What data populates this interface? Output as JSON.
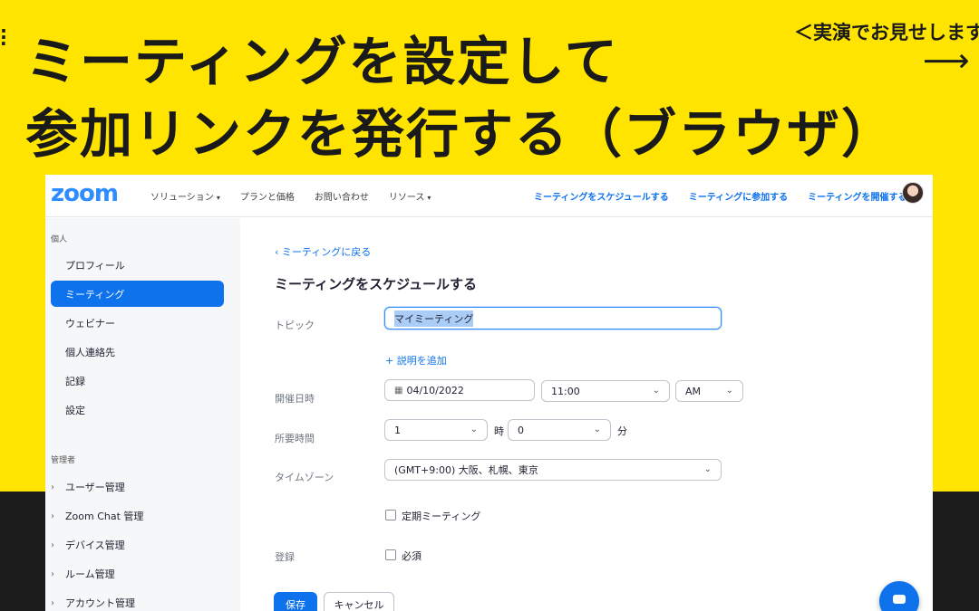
{
  "slide": {
    "title_line1": "ミーティングを設定して",
    "title_line2": "参加リンクを発行する（ブラウザ）",
    "demo_note": "＜実演でお見せします",
    "arrow": "⟶"
  },
  "colors": {
    "background": "#FFE400",
    "accent": "#0e72ed",
    "brand": "#2D8CFF"
  },
  "topnav": {
    "logo": "zoom",
    "left_items": [
      "ソリューション",
      "プランと価格",
      "お問い合わせ",
      "リソース"
    ],
    "right_items": [
      "ミーティングをスケジュールする",
      "ミーティングに参加する",
      "ミーティングを開催する"
    ]
  },
  "sidebar": {
    "personal_header": "個人",
    "items": [
      "プロフィール",
      "ミーティング",
      "ウェビナー",
      "個人連絡先",
      "記録",
      "設定"
    ],
    "active_index": 1,
    "admin_header": "管理者",
    "admin_items": [
      "ユーザー管理",
      "Zoom Chat 管理",
      "デバイス管理",
      "ルーム管理",
      "アカウント管理"
    ]
  },
  "form": {
    "back_link": "ミーティングに戻る",
    "heading": "ミーティングをスケジュールする",
    "topic_label": "トピック",
    "topic_value": "マイミーティング",
    "add_description": "説明を追加",
    "date_label": "開催日時",
    "date_value": "04/10/2022",
    "time_value": "11:00",
    "ampm_value": "AM",
    "duration_label": "所要時間",
    "hours_value": "1",
    "hours_unit": "時",
    "minutes_value": "0",
    "minutes_unit": "分",
    "timezone_label": "タイムゾーン",
    "timezone_value": "(GMT+9:00) 大阪、札幌、東京",
    "recurring_label": "定期ミーティング",
    "registration_label": "登録",
    "required_label": "必須",
    "save_label": "保存",
    "cancel_label": "キャンセル"
  }
}
